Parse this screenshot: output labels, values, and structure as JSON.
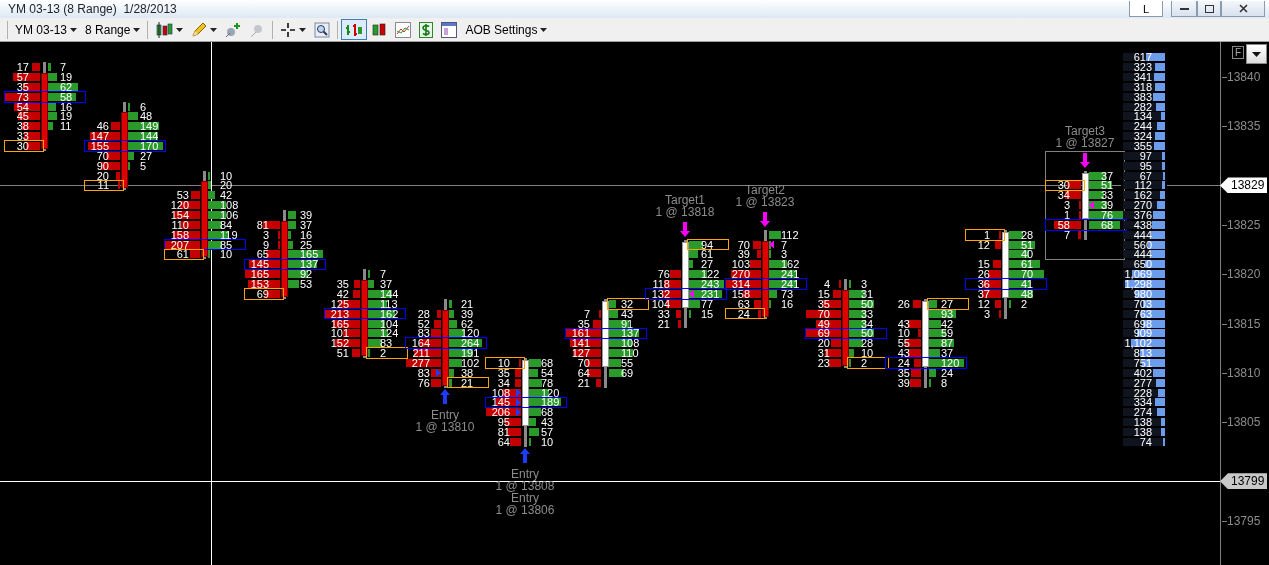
{
  "window": {
    "title": "YM 03-13 (8 Range)  1/28/2013",
    "menu_button": "L"
  },
  "toolbar": {
    "instrument": "YM 03-13",
    "period": "8 Range",
    "settings": "AOB Settings",
    "tool_buttons": [
      {
        "selected": false
      },
      {
        "selected": false
      },
      {
        "selected": false
      },
      {
        "selected": false
      },
      {
        "selected": false
      },
      {
        "selected": false
      },
      {
        "selected": true
      },
      {
        "selected": false
      },
      {
        "selected": false
      },
      {
        "selected": false
      },
      {
        "selected": false
      }
    ]
  },
  "chart": {
    "corner_button": "F",
    "price_axis": {
      "ticks": [
        "13840",
        "13835",
        "13825",
        "13820",
        "13815",
        "13810",
        "13805",
        "13795"
      ],
      "last_price": "13829",
      "crosshair_price": "13799"
    },
    "bars": [
      {
        "kind": "down",
        "rows": [
          {
            "bid": "17",
            "ask": "7"
          },
          {
            "bid": "57",
            "ask": "19"
          },
          {
            "bid": "35",
            "ask": "62"
          },
          {
            "bid": "73",
            "ask": "58",
            "kind": "poc"
          },
          {
            "bid": "54",
            "ask": "16"
          },
          {
            "bid": "45",
            "ask": "19"
          },
          {
            "bid": "38",
            "ask": "11"
          },
          {
            "bid": "33"
          },
          {
            "bid": "30",
            "kind": "close_bid"
          }
        ]
      },
      {
        "kind": "down",
        "rows": [
          {
            "ask": "6"
          },
          {
            "ask": "48"
          },
          {
            "bid": "46",
            "ask": "149"
          },
          {
            "bid": "147",
            "ask": "144"
          },
          {
            "bid": "155",
            "ask": "170",
            "kind": "poc"
          },
          {
            "bid": "70",
            "ask": "27"
          },
          {
            "bid": "90",
            "ask": "5"
          },
          {
            "bid": "20"
          },
          {
            "bid": "11",
            "kind": "close_bid"
          }
        ]
      },
      {
        "kind": "down",
        "rows": [
          {
            "ask": "10"
          },
          {
            "ask": "20"
          },
          {
            "bid": "53",
            "ask": "42"
          },
          {
            "bid": "120",
            "ask": "108"
          },
          {
            "bid": "154",
            "ask": "106"
          },
          {
            "bid": "110",
            "ask": "84"
          },
          {
            "bid": "158",
            "ask": "119"
          },
          {
            "bid": "207",
            "ask": "85",
            "kind": "poc"
          },
          {
            "bid": "61",
            "ask": "10",
            "kind": "close_bid"
          }
        ]
      },
      {
        "kind": "down",
        "rows": [
          {
            "ask": "39"
          },
          {
            "bid": "81",
            "ask": "37"
          },
          {
            "bid": "3",
            "ask": "16"
          },
          {
            "bid": "9",
            "ask": "25"
          },
          {
            "bid": "65",
            "ask": "165"
          },
          {
            "bid": "145",
            "ask": "137",
            "kind": "poc"
          },
          {
            "bid": "165",
            "ask": "92"
          },
          {
            "bid": "153",
            "ask": "53"
          },
          {
            "bid": "69",
            "kind": "close_bid"
          }
        ]
      },
      {
        "kind": "down",
        "rows": [
          {
            "ask": "7"
          },
          {
            "bid": "35",
            "ask": "37"
          },
          {
            "bid": "42",
            "ask": "144"
          },
          {
            "bid": "125",
            "ask": "113"
          },
          {
            "bid": "213",
            "ask": "162",
            "kind": "poc"
          },
          {
            "bid": "165",
            "ask": "104"
          },
          {
            "bid": "101",
            "ask": "124"
          },
          {
            "bid": "152",
            "ask": "83"
          },
          {
            "bid": "51",
            "ask": "2",
            "kind": "close_ask"
          }
        ]
      },
      {
        "kind": "down",
        "annotation": {
          "kind": "entry",
          "lines": [
            "Entry",
            "1 @ 13810"
          ]
        },
        "rows": [
          {
            "ask": "21"
          },
          {
            "bid": "28",
            "ask": "39"
          },
          {
            "bid": "52",
            "ask": "62"
          },
          {
            "bid": "83",
            "ask": "120"
          },
          {
            "bid": "164",
            "ask": "264",
            "kind": "poc"
          },
          {
            "bid": "211",
            "ask": "191"
          },
          {
            "bid": "277",
            "ask": "102"
          },
          {
            "bid": "83",
            "ask": "38",
            "filled": true
          },
          {
            "bid": "76",
            "ask": "21",
            "kind": "close_ask"
          }
        ]
      },
      {
        "kind": "up",
        "annotation": {
          "kind": "entry",
          "lines": [
            "Entry",
            "1 @ 13808",
            "Entry",
            "1 @ 13806"
          ]
        },
        "rows": [
          {
            "bid": "10",
            "ask": "68",
            "kind": "close_bid"
          },
          {
            "bid": "35",
            "ask": "54"
          },
          {
            "bid": "34",
            "ask": "78"
          },
          {
            "bid": "108",
            "ask": "120",
            "filled": true
          },
          {
            "bid": "145",
            "ask": "189",
            "kind": "poc",
            "filled": true
          },
          {
            "bid": "206",
            "ask": "68",
            "filled": true
          },
          {
            "bid": "95",
            "ask": "43"
          },
          {
            "bid": "81",
            "ask": "57"
          },
          {
            "bid": "64",
            "ask": "10"
          }
        ]
      },
      {
        "kind": "up",
        "rows": [
          {
            "ask": "32",
            "kind": "close_ask"
          },
          {
            "bid": "7",
            "ask": "43"
          },
          {
            "bid": "35",
            "ask": "91"
          },
          {
            "bid": "161",
            "ask": "137",
            "kind": "poc"
          },
          {
            "bid": "141",
            "ask": "108"
          },
          {
            "bid": "127",
            "ask": "110"
          },
          {
            "bid": "70",
            "ask": "55"
          },
          {
            "bid": "64",
            "ask": "69"
          },
          {
            "bid": "21"
          }
        ]
      },
      {
        "kind": "up",
        "annotation": {
          "kind": "target",
          "lines": [
            "Target1",
            "1 @ 13818"
          ]
        },
        "rows": [
          {
            "ask": "94",
            "kind": "close_ask"
          },
          {
            "ask": "61"
          },
          {
            "ask": "27"
          },
          {
            "bid": "76",
            "ask": "122"
          },
          {
            "bid": "118",
            "ask": "243"
          },
          {
            "bid": "132",
            "ask": "231",
            "kind": "poc",
            "filled": true
          },
          {
            "bid": "104",
            "ask": "77"
          },
          {
            "bid": "33",
            "ask": "15"
          },
          {
            "bid": "21"
          }
        ]
      },
      {
        "kind": "down",
        "annotation": {
          "kind": "target",
          "lines": [
            "Target2",
            "1 @ 13823"
          ]
        },
        "rows": [
          {
            "ask": "112"
          },
          {
            "bid": "70",
            "ask": "7",
            "filled": true
          },
          {
            "bid": "39",
            "ask": "3"
          },
          {
            "bid": "103",
            "ask": "162"
          },
          {
            "bid": "270",
            "ask": "241"
          },
          {
            "bid": "314",
            "ask": "241",
            "kind": "poc"
          },
          {
            "bid": "158",
            "ask": "73"
          },
          {
            "bid": "63",
            "ask": "16"
          },
          {
            "bid": "24",
            "kind": "close_bid"
          }
        ]
      },
      {
        "kind": "down",
        "rows": [
          {
            "bid": "4",
            "ask": "3"
          },
          {
            "bid": "15",
            "ask": "31"
          },
          {
            "bid": "35",
            "ask": "50"
          },
          {
            "bid": "70",
            "ask": "33"
          },
          {
            "bid": "49",
            "ask": "34"
          },
          {
            "bid": "69",
            "ask": "50",
            "kind": "poc"
          },
          {
            "bid": "20",
            "ask": "28"
          },
          {
            "bid": "31",
            "ask": "10"
          },
          {
            "bid": "23",
            "ask": "2",
            "kind": "close_ask"
          }
        ]
      },
      {
        "kind": "up",
        "rows": [
          {
            "bid": "26",
            "ask": "27",
            "kind": "close_ask"
          },
          {
            "ask": "93"
          },
          {
            "bid": "43",
            "ask": "42"
          },
          {
            "bid": "10",
            "ask": "59"
          },
          {
            "bid": "55",
            "ask": "87"
          },
          {
            "bid": "43",
            "ask": "37"
          },
          {
            "bid": "24",
            "ask": "120",
            "kind": "poc"
          },
          {
            "bid": "35",
            "ask": "24"
          },
          {
            "bid": "39",
            "ask": "8"
          }
        ]
      },
      {
        "kind": "up",
        "rows": [
          {
            "bid": "1",
            "ask": "28",
            "kind": "close_bid"
          },
          {
            "bid": "12",
            "ask": "51"
          },
          {
            "ask": "40"
          },
          {
            "bid": "15",
            "ask": "61"
          },
          {
            "bid": "26",
            "ask": "70"
          },
          {
            "bid": "36",
            "ask": "41",
            "kind": "poc"
          },
          {
            "bid": "37",
            "ask": "48"
          },
          {
            "bid": "12",
            "ask": "2"
          },
          {
            "bid": "3"
          }
        ]
      },
      {
        "kind": "up",
        "boxed": true,
        "annotation": {
          "kind": "target",
          "lines": [
            "Target3",
            "1 @ 13827"
          ]
        },
        "rows": [
          {
            "ask": "37"
          },
          {
            "bid": "30",
            "ask": "51",
            "kind": "close_bid"
          },
          {
            "bid": "34",
            "ask": "33"
          },
          {
            "bid": "3",
            "ask": "39",
            "filled": true
          },
          {
            "bid": "1",
            "ask": "76"
          },
          {
            "bid": "58",
            "ask": "68",
            "kind": "poc"
          },
          {
            "bid": "7"
          }
        ]
      }
    ],
    "volume_profile": [
      {
        "value": "617",
        "level": 0.475
      },
      {
        "value": "323",
        "level": 0.249
      },
      {
        "value": "341",
        "level": 0.263
      },
      {
        "value": "318",
        "level": 0.245
      },
      {
        "value": "383",
        "level": 0.295
      },
      {
        "value": "282",
        "level": 0.217
      },
      {
        "value": "134",
        "level": 0.103
      },
      {
        "value": "244",
        "level": 0.188
      },
      {
        "value": "324",
        "level": 0.25
      },
      {
        "value": "355",
        "level": 0.273
      },
      {
        "value": "97",
        "level": 0.075
      },
      {
        "value": "95",
        "level": 0.073
      },
      {
        "value": "67",
        "level": 0.052
      },
      {
        "value": "112",
        "level": 0.086
      },
      {
        "value": "162",
        "level": 0.125
      },
      {
        "value": "270",
        "level": 0.208
      },
      {
        "value": "376",
        "level": 0.29
      },
      {
        "value": "438",
        "level": 0.337
      },
      {
        "value": "444",
        "level": 0.342
      },
      {
        "value": "560",
        "level": 0.431
      },
      {
        "value": "444",
        "level": 0.342
      },
      {
        "value": "650",
        "level": 0.501
      },
      {
        "value": "1,069",
        "level": 0.824
      },
      {
        "value": "1,298",
        "level": 1
      },
      {
        "value": "980",
        "level": 0.755
      },
      {
        "value": "703",
        "level": 0.542
      },
      {
        "value": "763",
        "level": 0.588
      },
      {
        "value": "698",
        "level": 0.538
      },
      {
        "value": "909",
        "level": 0.7
      },
      {
        "value": "1,102",
        "level": 0.849
      },
      {
        "value": "813",
        "level": 0.626
      },
      {
        "value": "751",
        "level": 0.579
      },
      {
        "value": "402",
        "level": 0.31
      },
      {
        "value": "277",
        "level": 0.213
      },
      {
        "value": "228",
        "level": 0.176
      },
      {
        "value": "334",
        "level": 0.257
      },
      {
        "value": "274",
        "level": 0.211
      },
      {
        "value": "138",
        "level": 0.106
      },
      {
        "value": "138",
        "level": 0.106
      },
      {
        "value": "74",
        "level": 0.057
      }
    ]
  }
}
